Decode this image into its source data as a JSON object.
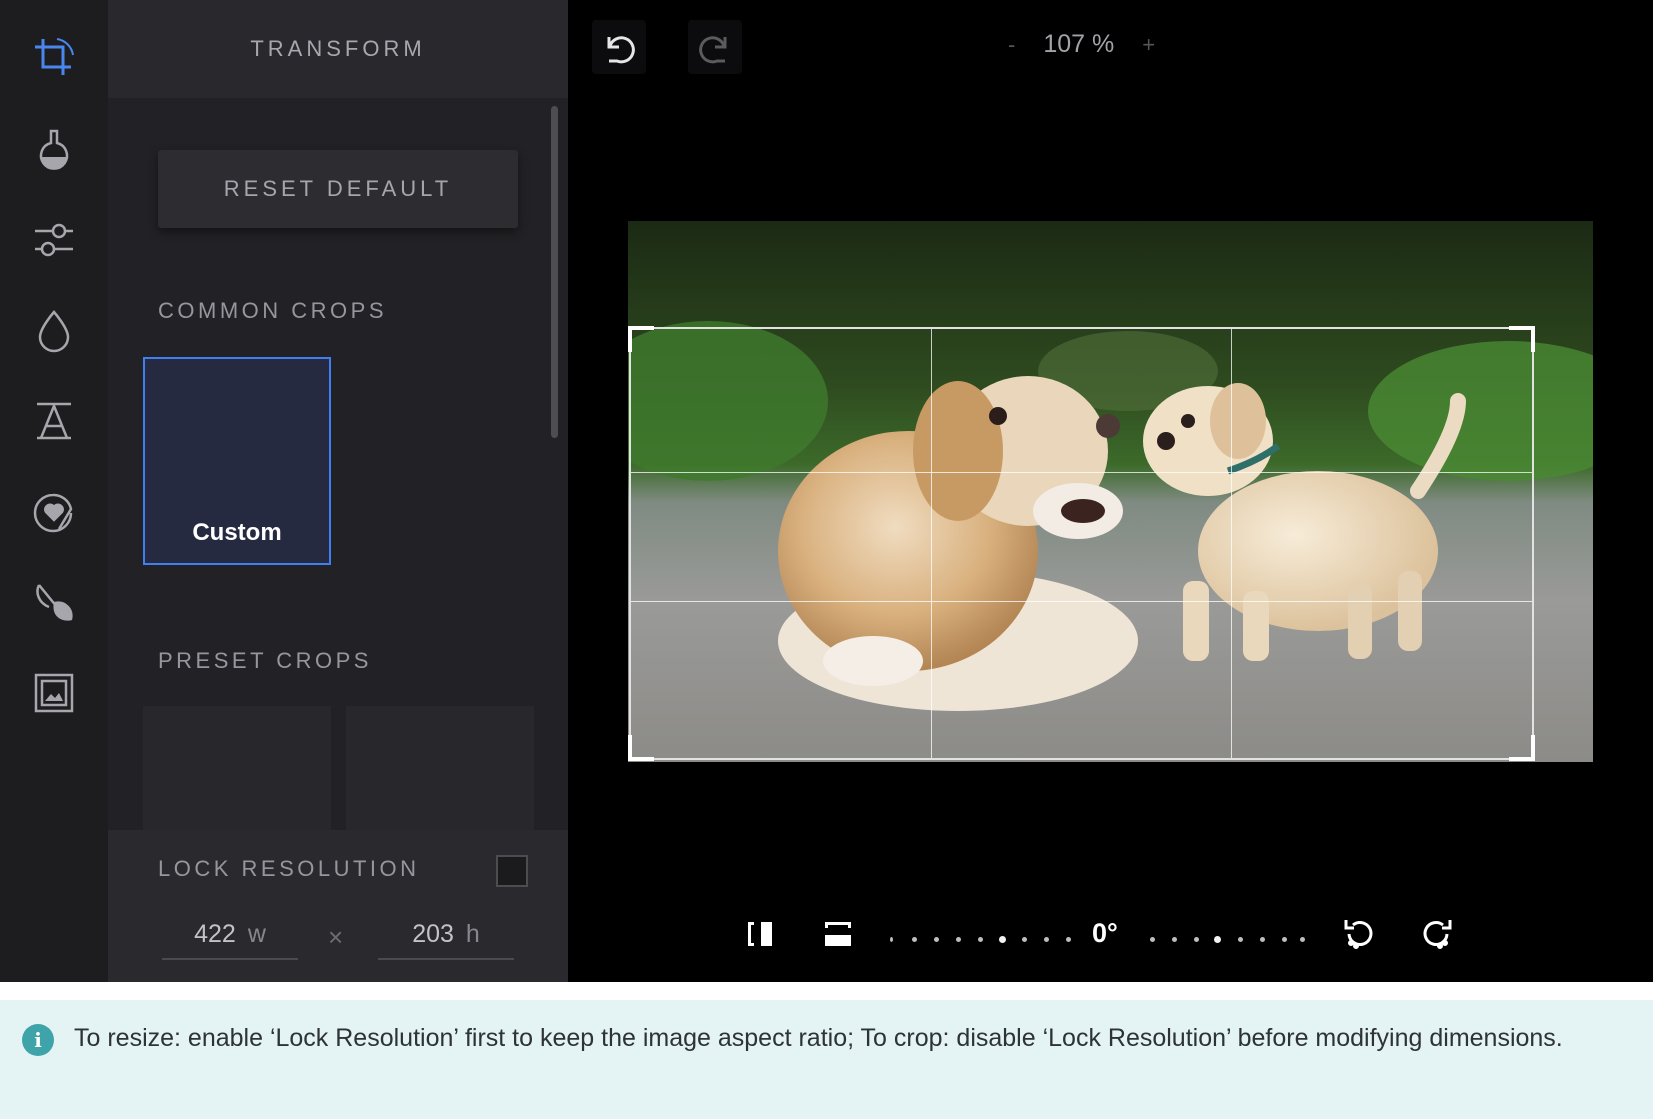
{
  "colors": {
    "accent": "#3f7ff2",
    "info_bg": "#e4f3f3",
    "info_icon": "#3fa4a9"
  },
  "rail": {
    "items": [
      {
        "name": "transform",
        "icon": "crop-icon",
        "active": true
      },
      {
        "name": "filters",
        "icon": "flask-icon"
      },
      {
        "name": "adjust",
        "icon": "sliders-icon"
      },
      {
        "name": "focus",
        "icon": "drop-icon"
      },
      {
        "name": "text",
        "icon": "text-icon"
      },
      {
        "name": "stickers",
        "icon": "sticker-icon"
      },
      {
        "name": "brush",
        "icon": "brush-icon"
      },
      {
        "name": "frames",
        "icon": "frame-icon"
      }
    ]
  },
  "panel": {
    "title": "TRANSFORM",
    "reset_label": "RESET DEFAULT",
    "common_crops_label": "COMMON CROPS",
    "common_crops": [
      {
        "label": "Custom",
        "selected": true
      }
    ],
    "preset_crops_label": "PRESET CROPS",
    "lock": {
      "label": "LOCK RESOLUTION",
      "checked": false,
      "width": "422",
      "width_unit": "w",
      "separator": "×",
      "height": "203",
      "height_unit": "h"
    }
  },
  "toolbar": {
    "undo_icon": "undo-icon",
    "redo_icon": "redo-icon",
    "zoom_out": "-",
    "zoom_value": "107 %",
    "zoom_in": "+"
  },
  "bottom": {
    "flip_h_icon": "flip-horizontal-icon",
    "flip_v_icon": "flip-vertical-icon",
    "angle": "0°",
    "rotate_left_icon": "rotate-left-icon",
    "rotate_right_icon": "rotate-right-icon"
  },
  "info": {
    "icon": "i",
    "text": "To resize: enable ‘Lock Resolution’ first to keep the image aspect ratio; To crop: disable ‘Lock Resolution’ before modifying dimensions."
  }
}
